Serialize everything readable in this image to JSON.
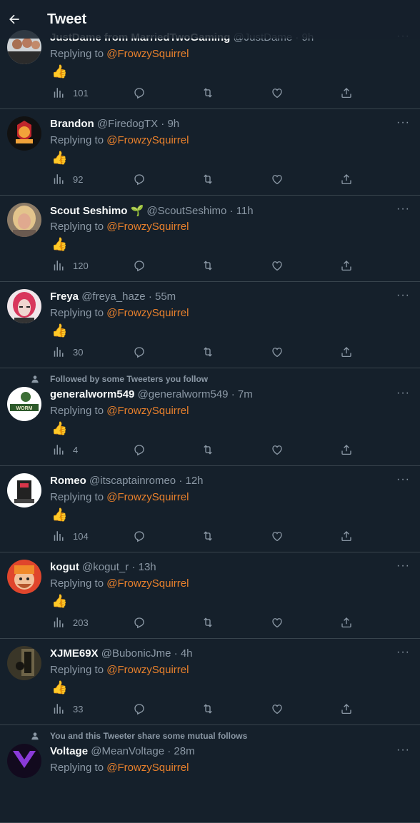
{
  "header": {
    "title": "Tweet",
    "back_icon": "arrow-left-icon"
  },
  "colors": {
    "background": "#15202b",
    "border": "#38444d",
    "muted": "#8b98a5",
    "mention": "#e8802c",
    "text": "#f7f9f9"
  },
  "tweets": [
    {
      "name": "JustDame from MarriedTwoGaming",
      "handle": "@JustDame",
      "time": "9h",
      "reply_prefix": "Replying to",
      "mention": "@FrowzySquirrel",
      "emoji": "👍",
      "views": "101",
      "avatar": "group-photo"
    },
    {
      "name": "Brandon",
      "handle": "@FiredogTX",
      "time": "9h",
      "reply_prefix": "Replying to",
      "mention": "@FrowzySquirrel",
      "emoji": "👍",
      "views": "92",
      "avatar": "firedog-logo"
    },
    {
      "name": "Scout Seshimo",
      "badge": "🌱",
      "handle": "@ScoutSeshimo",
      "time": "11h",
      "reply_prefix": "Replying to",
      "mention": "@FrowzySquirrel",
      "emoji": "👍",
      "views": "120",
      "avatar": "blonde-portrait"
    },
    {
      "name": "Freya",
      "handle": "@freya_haze",
      "time": "55m",
      "reply_prefix": "Replying to",
      "mention": "@FrowzySquirrel",
      "emoji": "👍",
      "views": "30",
      "avatar": "red-hair-portrait"
    },
    {
      "social": "Followed by some Tweeters you follow",
      "name": "generalworm549",
      "handle": "@generalworm549",
      "time": "7m",
      "reply_prefix": "Replying to",
      "mention": "@FrowzySquirrel",
      "emoji": "👍",
      "views": "4",
      "avatar": "worm-logo"
    },
    {
      "name": "Romeo",
      "handle": "@itscaptainromeo",
      "time": "12h",
      "reply_prefix": "Replying to",
      "mention": "@FrowzySquirrel",
      "emoji": "👍",
      "views": "104",
      "avatar": "captain-logo"
    },
    {
      "name": "kogut",
      "handle": "@kogut_r",
      "time": "13h",
      "reply_prefix": "Replying to",
      "mention": "@FrowzySquirrel",
      "emoji": "👍",
      "views": "203",
      "avatar": "cartoon-face"
    },
    {
      "name": "XJME69X",
      "handle": "@BubonicJme",
      "time": "4h",
      "reply_prefix": "Replying to",
      "mention": "@FrowzySquirrel",
      "emoji": "👍",
      "views": "33",
      "avatar": "dark-doorway"
    },
    {
      "social": "You and this Tweeter share some mutual follows",
      "name": "Voltage",
      "handle": "@MeanVoltage",
      "time": "28m",
      "reply_prefix": "Replying to",
      "mention": "@FrowzySquirrel",
      "avatar": "purple-logo"
    }
  ],
  "action_icons": [
    "analytics-icon",
    "reply-icon",
    "retweet-icon",
    "like-icon",
    "share-icon"
  ]
}
